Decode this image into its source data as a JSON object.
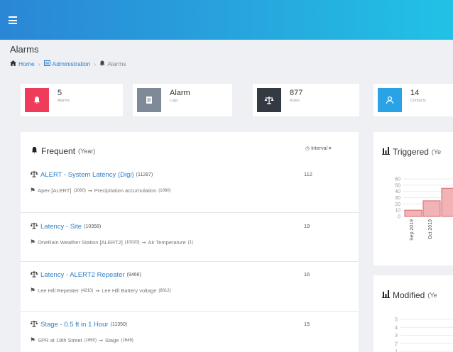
{
  "colors": {
    "topbar_start": "#2a86d6",
    "topbar_end": "#21c2e6",
    "link": "#2f80c8",
    "alarms_card": "#ef3c5a",
    "logs_card": "#7f8a98",
    "rules_card": "#333a42",
    "contacts_card": "#2aa2e6",
    "bar_fill": "#f1b3b6",
    "bar_stroke": "#d7676b"
  },
  "page": {
    "title": "Alarms"
  },
  "breadcrumb": {
    "home": "Home",
    "admin": "Administration",
    "current": "Alarms"
  },
  "stats": [
    {
      "value": "5",
      "label": "Alarms",
      "icon": "bell-icon"
    },
    {
      "value": "Alarm",
      "label": "Logs",
      "icon": "document-icon"
    },
    {
      "value": "877",
      "label": "Rules",
      "icon": "scale-icon"
    },
    {
      "value": "14",
      "label": "Contacts",
      "icon": "person-icon"
    }
  ],
  "frequent": {
    "title": "Frequent",
    "period": "(Year)",
    "interval_label": "Interval",
    "rows": [
      {
        "title": "ALERT - System Latency (Digi)",
        "title_id": "(11287)",
        "count": "112",
        "source": "Apex [ALERT]",
        "source_id": "(1060)",
        "target": "Precipitation accumulation",
        "target_id": "(1060)"
      },
      {
        "title": "Latency - Site",
        "title_id": "(10358)",
        "count": "19",
        "source": "OneRain Weather Station [ALERT2]",
        "source_id": "(10020)",
        "target": "Air Temperature",
        "target_id": "(1)"
      },
      {
        "title": "Latency - ALERT2 Repeater",
        "title_id": "(9466)",
        "count": "16",
        "source": "Lee Hill Repeater",
        "source_id": "(4210)",
        "target": "Lee Hill Battery voltage",
        "target_id": "(8012)"
      },
      {
        "title": "Stage - 0.5 ft in 1 Hour",
        "title_id": "(11350)",
        "count": "15",
        "source": "SPR at 19th Street",
        "source_id": "(1650)",
        "target": "Stage",
        "target_id": "(1649)"
      }
    ]
  },
  "triggered": {
    "title": "Triggered",
    "period": "(Ye"
  },
  "modified": {
    "title": "Modified",
    "period": "(Ye"
  },
  "chart_data": [
    {
      "type": "bar",
      "categories": [
        "Sep 2019",
        "Oct 2019",
        ""
      ],
      "values": [
        10,
        25,
        45
      ],
      "title": "Triggered",
      "ylim": [
        0,
        60
      ],
      "yticks": [
        "0",
        "10",
        "20",
        "30",
        "40",
        "50",
        "60"
      ],
      "grid": true
    },
    {
      "type": "bar",
      "categories": [],
      "values": [],
      "title": "Modified",
      "ylim": [
        1,
        5
      ],
      "yticks": [
        "1",
        "2",
        "3",
        "4",
        "5"
      ],
      "grid": true
    }
  ]
}
